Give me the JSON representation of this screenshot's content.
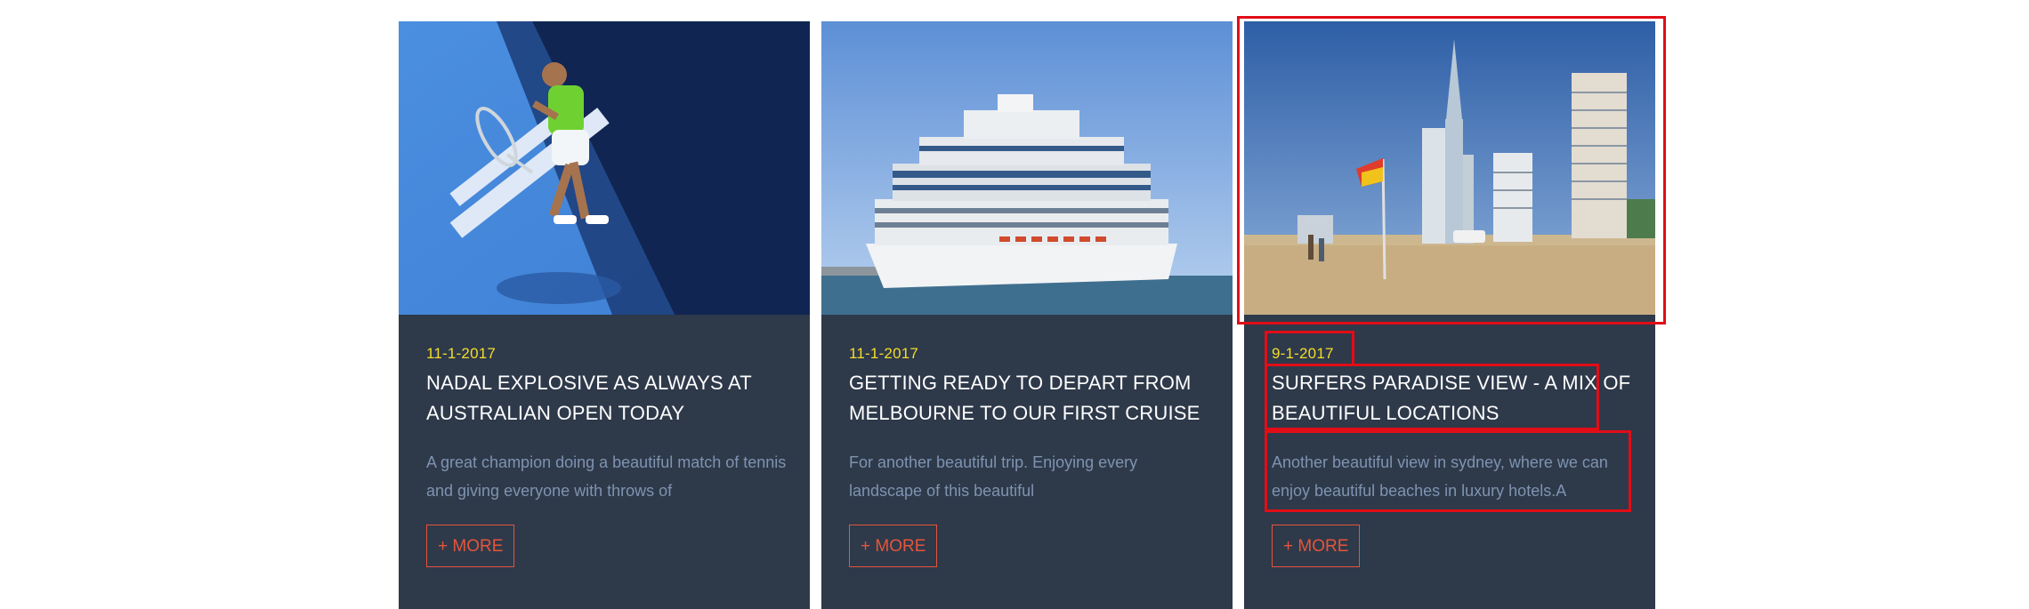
{
  "posts": [
    {
      "date": "11-1-2017",
      "title": "NADAL EXPLOSIVE AS ALWAYS AT AUSTRALIAN OPEN TODAY",
      "excerpt": "A great champion doing a beautiful match of tennis and giving everyone with throws of",
      "more_label": "+ MORE",
      "image_icon": "tennis-player-photo"
    },
    {
      "date": "11-1-2017",
      "title": "GETTING READY TO DEPART FROM MELBOURNE TO OUR FIRST CRUISE",
      "excerpt": "For another beautiful trip. Enjoying every landscape of this beautiful",
      "more_label": "+ MORE",
      "image_icon": "cruise-ship-photo"
    },
    {
      "date": "9-1-2017",
      "title": "SURFERS PARADISE VIEW - A MIX OF BEAUTIFUL LOCATIONS",
      "excerpt": "Another beautiful view in sydney, where we can enjoy beautiful beaches in luxury hotels.A",
      "more_label": "+ MORE",
      "image_icon": "beach-skyline-photo"
    }
  ],
  "colors": {
    "card_bg": "#2e394a",
    "date": "#f3dd2a",
    "title": "#ffffff",
    "excerpt": "#7f93b0",
    "more": "#e5553b",
    "highlight": "#e10d17"
  }
}
